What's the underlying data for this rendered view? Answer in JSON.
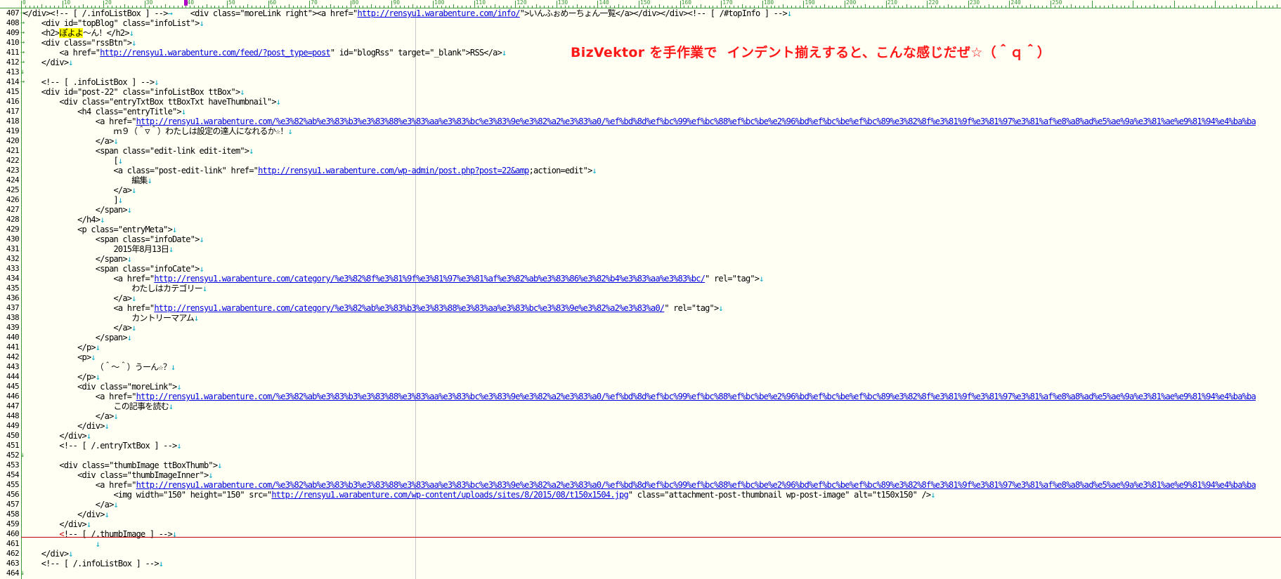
{
  "ruler": {
    "labels": [
      "0",
      "10",
      "20",
      "30",
      "40",
      "50",
      "60",
      "70",
      "80",
      "90",
      "100",
      "110",
      "120",
      "130",
      "140",
      "150",
      "160",
      "170",
      "180",
      "190",
      "200",
      "210",
      "220",
      "230",
      "240",
      "250"
    ]
  },
  "annotation": "BizVektor を手作業で  インデント揃えすると、こんな感じだぜ☆（＾ｑ＾）",
  "lines": [
    {
      "n": "407",
      "m": "→",
      "segs": [
        {
          "t": "</div><!-- [ /.infoListBox ] -->"
        },
        {
          "t": "→",
          "c": "nl"
        },
        {
          "t": "    <div class=\"moreLink right\"><a href=\""
        },
        {
          "t": "http://rensyu1.warabenture.com/info/",
          "c": "u"
        },
        {
          "t": "\">いんふぉめーちょん一覧</a></div></div><!-- [ /#topInfo ] -->"
        },
        {
          "t": "↓",
          "c": "nl"
        }
      ]
    },
    {
      "n": "408",
      "m": "→",
      "segs": [
        {
          "t": "    <div id=\"topBlog\" class=\"infoList\">"
        },
        {
          "t": "↓",
          "c": "nl"
        }
      ]
    },
    {
      "n": "409",
      "m": "→",
      "segs": [
        {
          "t": "    <h2>"
        },
        {
          "t": "ぽよよ",
          "c": "hl"
        },
        {
          "t": "～ん！</h2>"
        },
        {
          "t": "↓",
          "c": "nl"
        }
      ]
    },
    {
      "n": "410",
      "m": "→",
      "segs": [
        {
          "t": "    <div class=\"rssBtn\">"
        },
        {
          "t": "↓",
          "c": "nl"
        }
      ]
    },
    {
      "n": "411",
      "m": "→",
      "segs": [
        {
          "t": "        <a href=\""
        },
        {
          "t": "http://rensyu1.warabenture.com/feed/?post_type=post",
          "c": "u"
        },
        {
          "t": "\" id=\"blogRss\" target=\"_blank\">RSS</a>"
        },
        {
          "t": "↓",
          "c": "nl"
        }
      ]
    },
    {
      "n": "412",
      "m": "→",
      "segs": [
        {
          "t": "    </div>"
        },
        {
          "t": "↓",
          "c": "nl"
        }
      ]
    },
    {
      "n": "413",
      "m": "↓",
      "segs": []
    },
    {
      "n": "414",
      "m": "→",
      "segs": [
        {
          "t": "    <!-- [ .infoListBox ] -->"
        },
        {
          "t": "↓",
          "c": "nl"
        }
      ]
    },
    {
      "n": "415",
      "m": "",
      "segs": [
        {
          "t": "    <div id=\"post-22\" class=\"infoListBox ttBox\">"
        },
        {
          "t": "↓",
          "c": "nl"
        }
      ]
    },
    {
      "n": "416",
      "m": "",
      "segs": [
        {
          "t": "        <div class=\"entryTxtBox ttBoxTxt haveThumbnail\">"
        },
        {
          "t": "↓",
          "c": "nl"
        }
      ]
    },
    {
      "n": "417",
      "m": "",
      "segs": [
        {
          "t": "            <h4 class=\"entryTitle\">"
        },
        {
          "t": "↓",
          "c": "nl"
        }
      ]
    },
    {
      "n": "418",
      "m": "",
      "segs": [
        {
          "t": "                <a href=\""
        },
        {
          "t": "http://rensyu1.warabenture.com/%e3%82%ab%e3%83%b3%e3%83%88%e3%83%aa%e3%83%bc%e3%83%9e%e3%82%a2%e3%83%a0/%ef%bd%8d%ef%bc%99%ef%bc%88%ef%bc%be%e2%96%bd%ef%bc%be%ef%bc%89%e3%82%8f%e3%81%9f%e3%81%97%e3%81%af%e8%a8%ad%e5%ae%9a%e3%81%ae%e9%81%94%e4%ba%ba",
          "c": "u"
        }
      ]
    },
    {
      "n": "419",
      "m": "",
      "segs": [
        {
          "t": "                    ｍ９（＾▽＾）わたしは設定の達人になれるか☆！"
        },
        {
          "t": "↓",
          "c": "nl"
        }
      ]
    },
    {
      "n": "420",
      "m": "",
      "segs": [
        {
          "t": "                </a>"
        },
        {
          "t": "↓",
          "c": "nl"
        }
      ]
    },
    {
      "n": "421",
      "m": "",
      "segs": [
        {
          "t": "                <span class=\"edit-link edit-item\">"
        },
        {
          "t": "↓",
          "c": "nl"
        }
      ]
    },
    {
      "n": "422",
      "m": "",
      "segs": [
        {
          "t": "                    ["
        },
        {
          "t": "↓",
          "c": "nl"
        }
      ]
    },
    {
      "n": "423",
      "m": "",
      "segs": [
        {
          "t": "                    <a class=\"post-edit-link\" href=\""
        },
        {
          "t": "http://rensyu1.warabenture.com/wp-admin/post.php?post=22&amp",
          "c": "u"
        },
        {
          "t": ";action=edit\">"
        },
        {
          "t": "↓",
          "c": "nl"
        }
      ]
    },
    {
      "n": "424",
      "m": "",
      "segs": [
        {
          "t": "                        編集"
        },
        {
          "t": "↓",
          "c": "nl"
        }
      ]
    },
    {
      "n": "425",
      "m": "",
      "segs": [
        {
          "t": "                    </a>"
        },
        {
          "t": "↓",
          "c": "nl"
        }
      ]
    },
    {
      "n": "426",
      "m": "",
      "segs": [
        {
          "t": "                    ]"
        },
        {
          "t": "↓",
          "c": "nl"
        }
      ]
    },
    {
      "n": "427",
      "m": "",
      "segs": [
        {
          "t": "                </span>"
        },
        {
          "t": "↓",
          "c": "nl"
        }
      ]
    },
    {
      "n": "428",
      "m": "",
      "segs": [
        {
          "t": "            </h4>"
        },
        {
          "t": "↓",
          "c": "nl"
        }
      ]
    },
    {
      "n": "429",
      "m": "",
      "segs": [
        {
          "t": "            <p class=\"entryMeta\">"
        },
        {
          "t": "↓",
          "c": "nl"
        }
      ]
    },
    {
      "n": "430",
      "m": "",
      "segs": [
        {
          "t": "                <span class=\"infoDate\">"
        },
        {
          "t": "↓",
          "c": "nl"
        }
      ]
    },
    {
      "n": "431",
      "m": "",
      "segs": [
        {
          "t": "                    2015年8月13日"
        },
        {
          "t": "↓",
          "c": "nl"
        }
      ]
    },
    {
      "n": "432",
      "m": "",
      "segs": [
        {
          "t": "                </span>"
        },
        {
          "t": "↓",
          "c": "nl"
        }
      ]
    },
    {
      "n": "433",
      "m": "",
      "segs": [
        {
          "t": "                <span class=\"infoCate\">"
        },
        {
          "t": "↓",
          "c": "nl"
        }
      ]
    },
    {
      "n": "434",
      "m": "",
      "segs": [
        {
          "t": "                    <a href=\""
        },
        {
          "t": "http://rensyu1.warabenture.com/category/%e3%82%8f%e3%81%9f%e3%81%97%e3%81%af%e3%82%ab%e3%83%86%e3%82%b4%e3%83%aa%e3%83%bc/",
          "c": "u"
        },
        {
          "t": "\" rel=\"tag\">"
        },
        {
          "t": "↓",
          "c": "nl"
        }
      ]
    },
    {
      "n": "435",
      "m": "",
      "segs": [
        {
          "t": "                        わたしはカテゴリー"
        },
        {
          "t": "↓",
          "c": "nl"
        }
      ]
    },
    {
      "n": "436",
      "m": "",
      "segs": [
        {
          "t": "                    </a>"
        },
        {
          "t": "↓",
          "c": "nl"
        }
      ]
    },
    {
      "n": "437",
      "m": "",
      "segs": [
        {
          "t": "                    <a href=\""
        },
        {
          "t": "http://rensyu1.warabenture.com/category/%e3%82%ab%e3%83%b3%e3%83%88%e3%83%aa%e3%83%bc%e3%83%9e%e3%82%a2%e3%83%a0/",
          "c": "u"
        },
        {
          "t": "\" rel=\"tag\">"
        },
        {
          "t": "↓",
          "c": "nl"
        }
      ]
    },
    {
      "n": "438",
      "m": "",
      "segs": [
        {
          "t": "                        カントリーマアム"
        },
        {
          "t": "↓",
          "c": "nl"
        }
      ]
    },
    {
      "n": "439",
      "m": "",
      "segs": [
        {
          "t": "                    </a>"
        },
        {
          "t": "↓",
          "c": "nl"
        }
      ]
    },
    {
      "n": "440",
      "m": "",
      "segs": [
        {
          "t": "                </span>"
        },
        {
          "t": "↓",
          "c": "nl"
        }
      ]
    },
    {
      "n": "441",
      "m": "",
      "segs": [
        {
          "t": "            </p>"
        },
        {
          "t": "↓",
          "c": "nl"
        }
      ]
    },
    {
      "n": "442",
      "m": "",
      "segs": [
        {
          "t": "            <p>"
        },
        {
          "t": "↓",
          "c": "nl"
        }
      ]
    },
    {
      "n": "443",
      "m": "",
      "segs": [
        {
          "t": "                （＾～＾）うーん☆？"
        },
        {
          "t": "↓",
          "c": "nl"
        }
      ]
    },
    {
      "n": "444",
      "m": "",
      "segs": [
        {
          "t": "            </p>"
        },
        {
          "t": "↓",
          "c": "nl"
        }
      ]
    },
    {
      "n": "445",
      "m": "",
      "segs": [
        {
          "t": "            <div class=\"moreLink\">"
        },
        {
          "t": "↓",
          "c": "nl"
        }
      ]
    },
    {
      "n": "446",
      "m": "",
      "segs": [
        {
          "t": "                <a href=\""
        },
        {
          "t": "http://rensyu1.warabenture.com/%e3%82%ab%e3%83%b3%e3%83%88%e3%83%aa%e3%83%bc%e3%83%9e%e3%82%a2%e3%83%a0/%ef%bd%8d%ef%bc%99%ef%bc%88%ef%bc%be%e2%96%bd%ef%bc%be%ef%bc%89%e3%82%8f%e3%81%9f%e3%81%97%e3%81%af%e8%a8%ad%e5%ae%9a%e3%81%ae%e9%81%94%e4%ba%ba",
          "c": "u"
        }
      ]
    },
    {
      "n": "447",
      "m": "",
      "segs": [
        {
          "t": "                    この記事を読む"
        },
        {
          "t": "↓",
          "c": "nl"
        }
      ]
    },
    {
      "n": "448",
      "m": "",
      "segs": [
        {
          "t": "                </a>"
        },
        {
          "t": "↓",
          "c": "nl"
        }
      ]
    },
    {
      "n": "449",
      "m": "",
      "segs": [
        {
          "t": "            </div>"
        },
        {
          "t": "↓",
          "c": "nl"
        }
      ]
    },
    {
      "n": "450",
      "m": "",
      "segs": [
        {
          "t": "        </div>"
        },
        {
          "t": "↓",
          "c": "nl"
        }
      ]
    },
    {
      "n": "451",
      "m": "",
      "segs": [
        {
          "t": "        <!-- [ /.entryTxtBox ] -->"
        },
        {
          "t": "↓",
          "c": "nl"
        }
      ]
    },
    {
      "n": "452",
      "m": "↓",
      "segs": []
    },
    {
      "n": "453",
      "m": "",
      "segs": [
        {
          "t": "        <div class=\"thumbImage ttBoxThumb\">"
        },
        {
          "t": "↓",
          "c": "nl"
        }
      ]
    },
    {
      "n": "454",
      "m": "",
      "segs": [
        {
          "t": "            <div class=\"thumbImageInner\">"
        },
        {
          "t": "↓",
          "c": "nl"
        }
      ]
    },
    {
      "n": "455",
      "m": "",
      "segs": [
        {
          "t": "                <a href=\""
        },
        {
          "t": "http://rensyu1.warabenture.com/%e3%82%ab%e3%83%b3%e3%83%88%e3%83%aa%e3%83%bc%e3%83%9e%e3%82%a2%e3%83%a0/%ef%bd%8d%ef%bc%99%ef%bc%88%ef%bc%be%e2%96%bd%ef%bc%be%ef%bc%89%e3%82%8f%e3%81%9f%e3%81%97%e3%81%af%e8%a8%ad%e5%ae%9a%e3%81%ae%e9%81%94%e4%ba%ba",
          "c": "u"
        }
      ]
    },
    {
      "n": "456",
      "m": "",
      "segs": [
        {
          "t": "                    <img width=\"150\" height=\"150\" src=\""
        },
        {
          "t": "http://rensyu1.warabenture.com/wp-content/uploads/sites/8/2015/08/t150x1504.jpg",
          "c": "u"
        },
        {
          "t": "\" class=\"attachment-post-thumbnail wp-post-image\" alt=\"t150x150\" />"
        },
        {
          "t": "↓",
          "c": "nl"
        }
      ]
    },
    {
      "n": "457",
      "m": "",
      "segs": [
        {
          "t": "                </a>"
        },
        {
          "t": "↓",
          "c": "nl"
        }
      ]
    },
    {
      "n": "458",
      "m": "",
      "segs": [
        {
          "t": "            </div>"
        },
        {
          "t": "↓",
          "c": "nl"
        }
      ]
    },
    {
      "n": "459",
      "m": "",
      "segs": [
        {
          "t": "        </div>"
        },
        {
          "t": "↓",
          "c": "nl"
        }
      ]
    },
    {
      "n": "460",
      "m": "",
      "segs": [
        {
          "t": "        "
        },
        {
          "t": "<",
          "c": "red"
        },
        {
          "t": "!-- [ /.thumbImage ] -->"
        },
        {
          "t": "↓",
          "c": "nl"
        }
      ]
    },
    {
      "n": "461",
      "m": "",
      "segs": [
        {
          "t": "                "
        },
        {
          "t": "↓",
          "c": "nl"
        }
      ]
    },
    {
      "n": "462",
      "m": "",
      "segs": [
        {
          "t": "    </div>"
        },
        {
          "t": "↓",
          "c": "nl"
        }
      ]
    },
    {
      "n": "463",
      "m": "",
      "segs": [
        {
          "t": "    <!-- [ /.infoListBox ] -->"
        },
        {
          "t": "↓",
          "c": "nl"
        }
      ]
    },
    {
      "n": "464",
      "m": "↓",
      "segs": []
    }
  ]
}
